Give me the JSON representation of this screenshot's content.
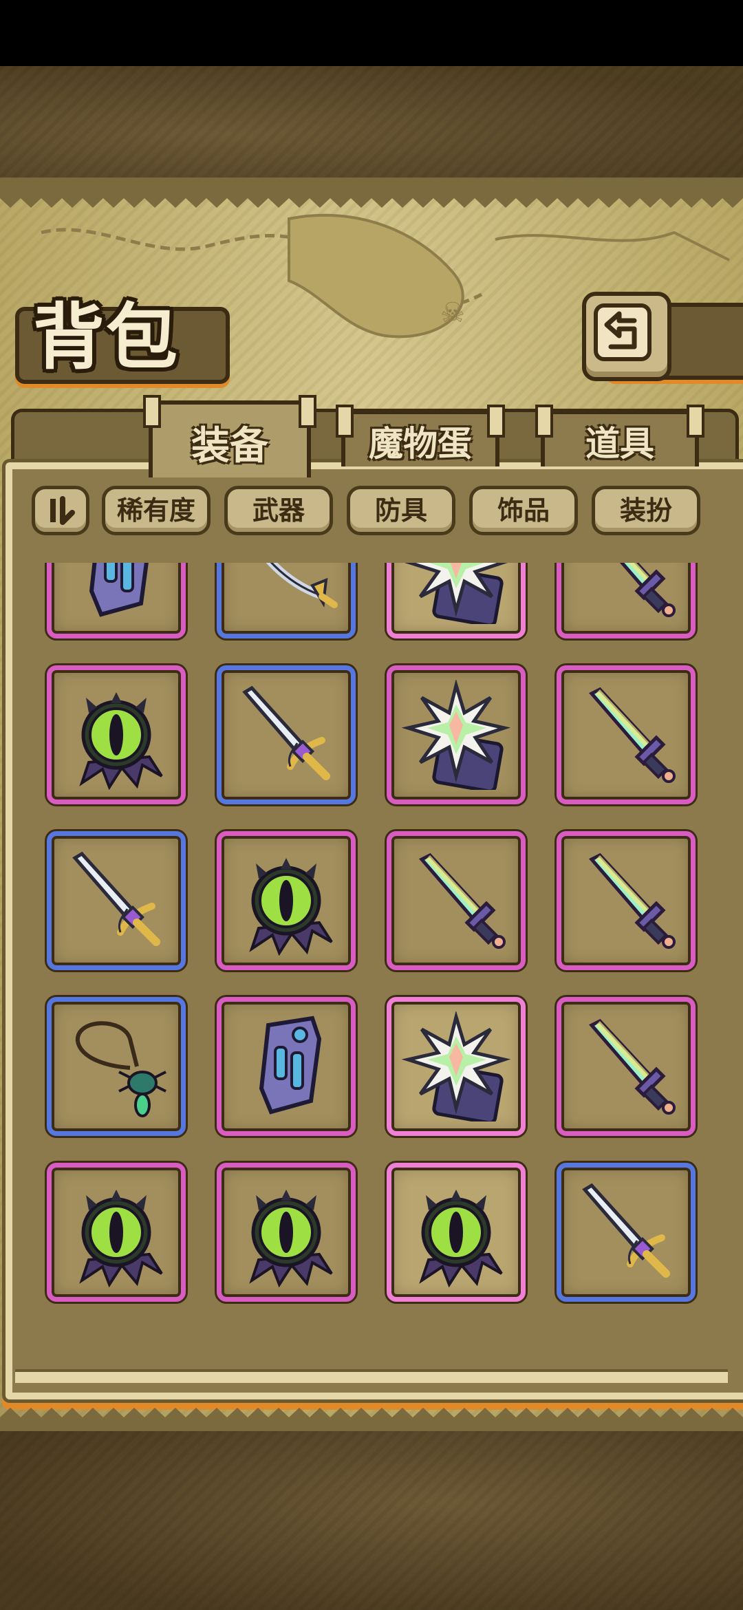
{
  "screen": {
    "title": "背包",
    "back_icon": "return-arrow-icon"
  },
  "tabs": [
    {
      "label": "装备",
      "active": true
    },
    {
      "label": "魔物蛋",
      "active": false
    },
    {
      "label": "道具",
      "active": false
    }
  ],
  "filters": {
    "sort_icon": "sort-toggle-icon",
    "items": [
      "稀有度",
      "武器",
      "防具",
      "饰品",
      "装扮"
    ]
  },
  "inventory": {
    "rows": [
      [
        {
          "item": "violet-bracer-icon",
          "rarity": "epic"
        },
        {
          "item": "curved-sabre-icon",
          "rarity": "rare"
        },
        {
          "item": "prism-star-shield-icon",
          "rarity": "legend"
        },
        {
          "item": "crystal-sword-icon",
          "rarity": "epic"
        }
      ],
      [
        {
          "item": "eye-amulet-icon",
          "rarity": "epic"
        },
        {
          "item": "silver-sword-icon",
          "rarity": "rare"
        },
        {
          "item": "prism-star-shield-icon",
          "rarity": "epic"
        },
        {
          "item": "crystal-sword-icon",
          "rarity": "epic"
        }
      ],
      [
        {
          "item": "silver-sword-icon",
          "rarity": "rare"
        },
        {
          "item": "eye-amulet-icon",
          "rarity": "epic"
        },
        {
          "item": "crystal-sword-icon",
          "rarity": "epic"
        },
        {
          "item": "crystal-sword-icon",
          "rarity": "epic"
        }
      ],
      [
        {
          "item": "spider-necklace-icon",
          "rarity": "rare"
        },
        {
          "item": "violet-bracer-icon",
          "rarity": "epic"
        },
        {
          "item": "prism-star-shield-icon",
          "rarity": "legend"
        },
        {
          "item": "crystal-sword-icon",
          "rarity": "epic"
        }
      ],
      [
        {
          "item": "eye-amulet-icon",
          "rarity": "epic"
        },
        {
          "item": "eye-amulet-icon",
          "rarity": "epic"
        },
        {
          "item": "eye-amulet-icon",
          "rarity": "legend"
        },
        {
          "item": "silver-sword-icon",
          "rarity": "rare"
        }
      ]
    ]
  },
  "colors": {
    "epic": "#d85cc2",
    "rare": "#5676e0",
    "legend": "#f07fd6",
    "accent": "#e08a2a",
    "parchment": "#c9b88a"
  }
}
